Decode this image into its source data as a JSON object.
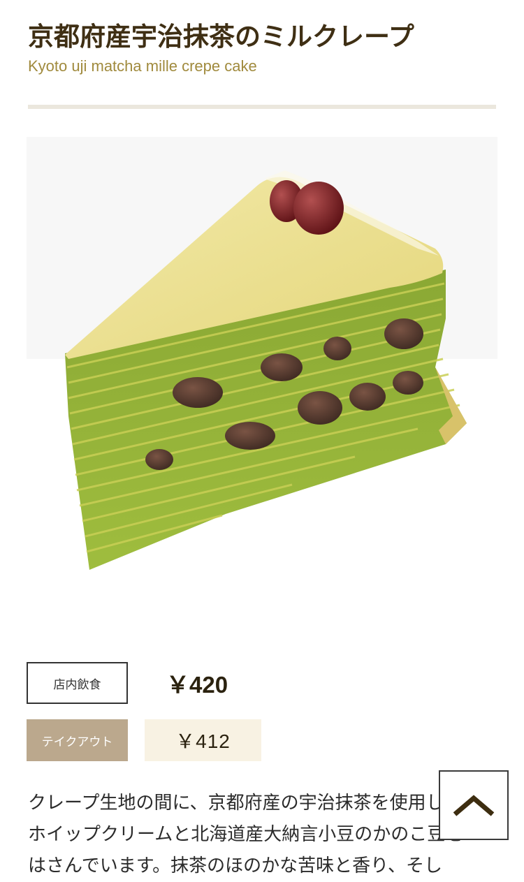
{
  "product": {
    "title": "京都府産宇治抹茶のミルクレープ",
    "subtitle": "Kyoto uji matcha mille crepe cake"
  },
  "prices": {
    "dine_in_label": "店内飲食",
    "dine_in_price": "￥420",
    "takeout_label": "テイクアウト",
    "takeout_price": "￥412"
  },
  "description": {
    "line1": "クレープ生地の間に、京都府産の宇治抹茶を使用した",
    "line2": "ホイップクリームと北海道産大納言小豆のかのこ豆を",
    "line3": "はさんでいます。抹茶のほのかな苦味と香り、そし"
  },
  "icons": {
    "back_to_top": "chevron-up-icon"
  },
  "colors": {
    "title": "#3f2f14",
    "subtitle": "#a08a3d",
    "takeout_bg": "#bba88d",
    "takeout_price_bg": "#f8f2e3"
  }
}
